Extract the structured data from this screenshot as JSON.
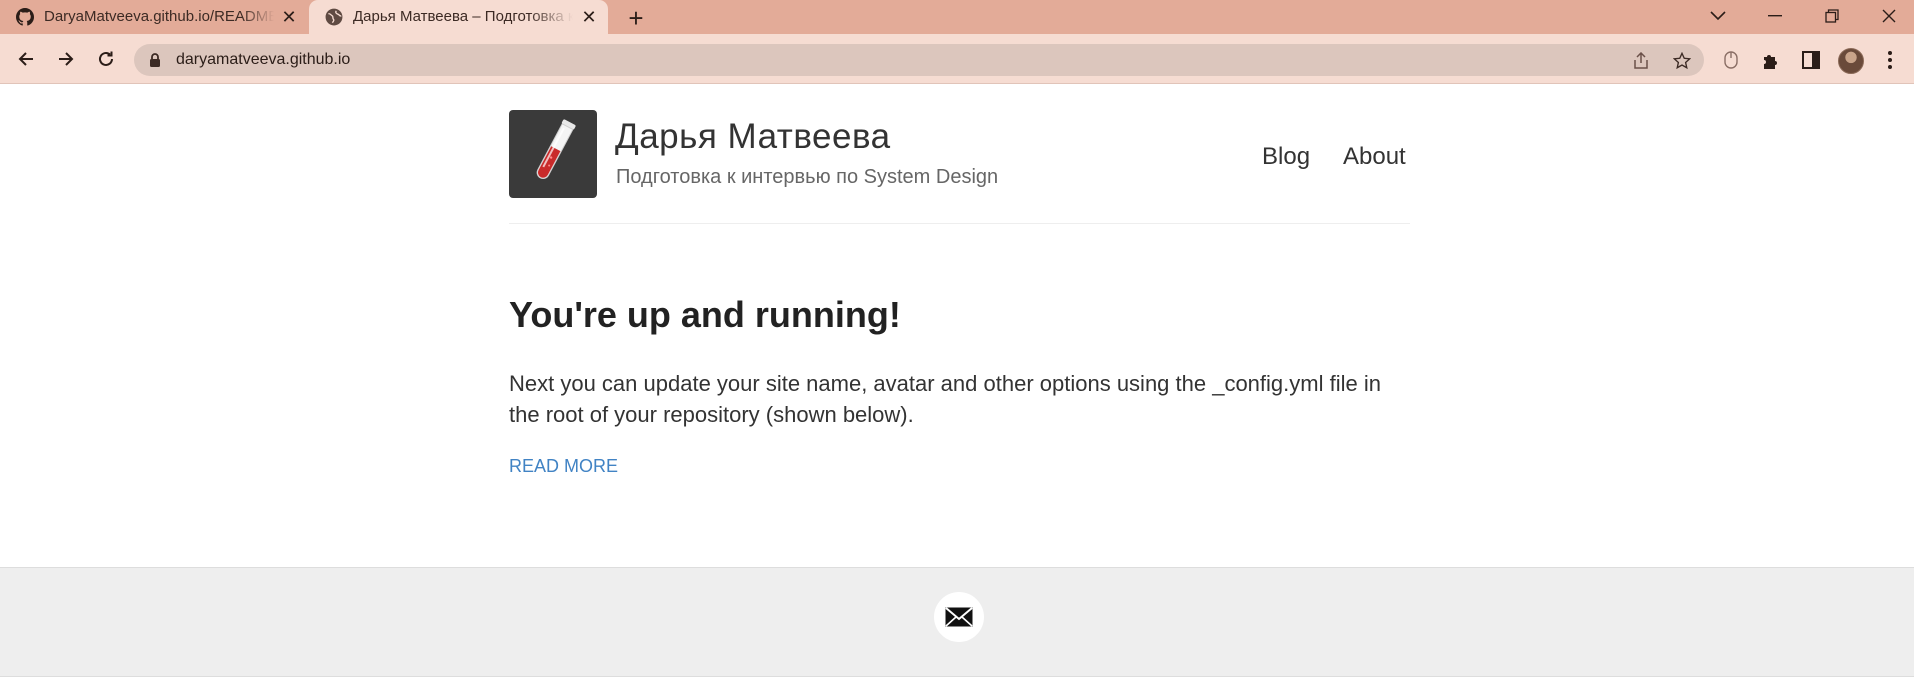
{
  "browser": {
    "tabs": [
      {
        "title": "DaryaMatveeva.github.io/README.md",
        "favicon": "github-icon",
        "active": false
      },
      {
        "title": "Дарья Матвеева – Подготовка к интервью по System Design",
        "favicon": "globe-icon",
        "active": true
      }
    ],
    "url": "daryamatveeva.github.io",
    "colors": {
      "frame": "#e3ab98",
      "toolbar": "#f6dcd2",
      "omnibox": "#dcc6bd"
    }
  },
  "site": {
    "name": "Дарья Матвеева",
    "description": "Подготовка к интервью по System Design",
    "logo": "test-tube-icon",
    "nav": [
      {
        "label": "Blog"
      },
      {
        "label": "About"
      }
    ]
  },
  "post": {
    "title": "You're up and running!",
    "excerpt": "Next you can update your site name, avatar and other options using the _config.yml file in the root of your repository (shown below).",
    "read_more": "READ MORE"
  },
  "footer": {
    "icons": [
      "envelope-icon"
    ]
  }
}
